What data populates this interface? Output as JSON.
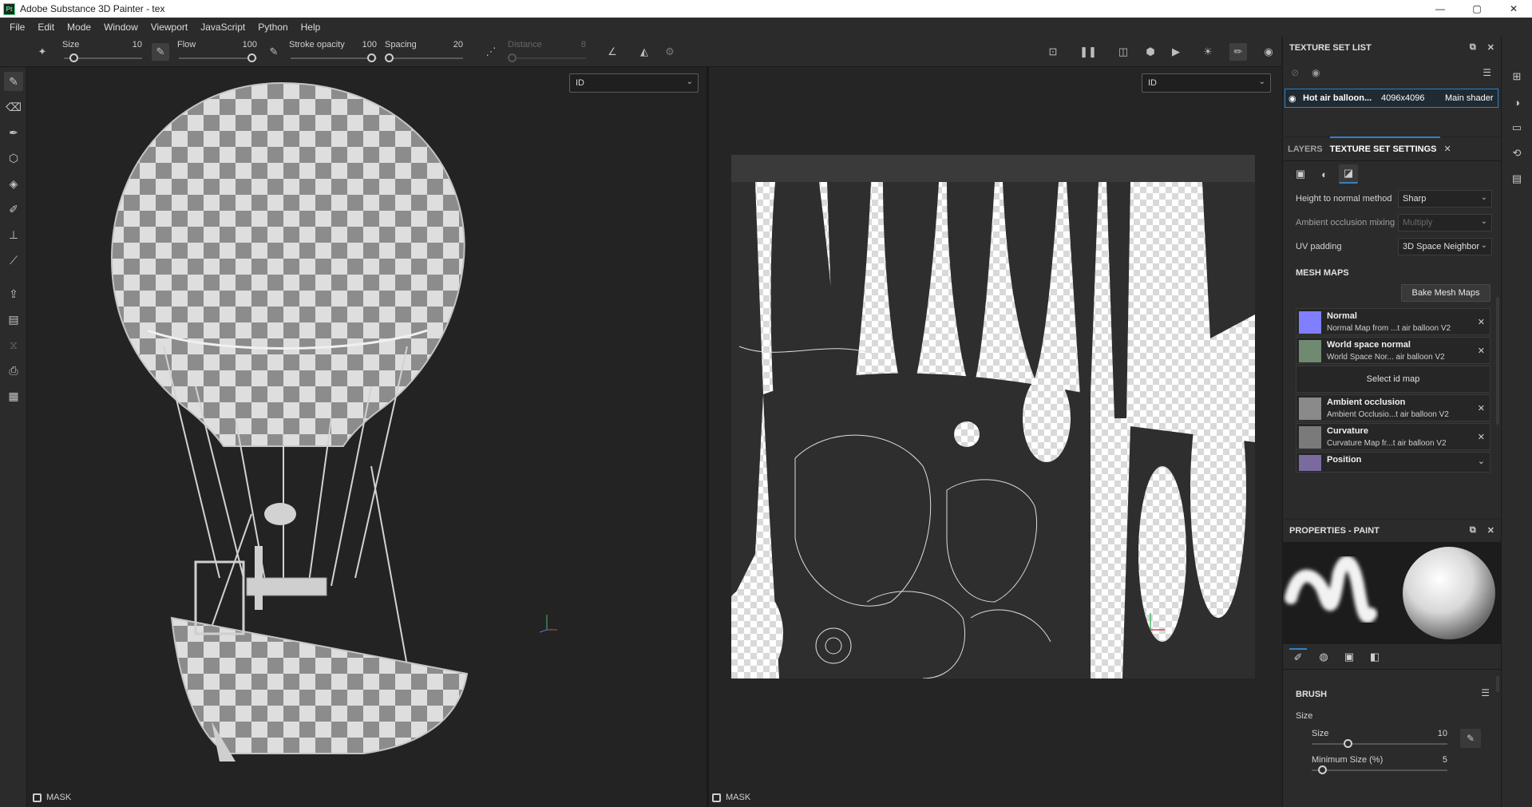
{
  "window": {
    "logo": "Pt",
    "title": "Adobe Substance 3D Painter - tex",
    "controls": [
      "—",
      "▢",
      "✕"
    ]
  },
  "menu": [
    "File",
    "Edit",
    "Mode",
    "Window",
    "Viewport",
    "JavaScript",
    "Python",
    "Help"
  ],
  "toolbar": {
    "size": {
      "label": "Size",
      "value": "10",
      "level": 0.1
    },
    "flow": {
      "label": "Flow",
      "value": "100",
      "level": 1.0
    },
    "stroke_opacity": {
      "label": "Stroke opacity",
      "value": "100",
      "level": 1.0
    },
    "spacing": {
      "label": "Spacing",
      "value": "20",
      "level": 0.0
    },
    "distance": {
      "label": "Distance",
      "value": "8",
      "level": 0.0
    }
  },
  "viewport_left": {
    "channel_select": "ID",
    "mask_label": "MASK"
  },
  "viewport_right": {
    "channel_select": "ID",
    "mask_label": "MASK"
  },
  "texture_set_list": {
    "title": "TEXTURE SET LIST",
    "item": {
      "name": "Hot air balloon...",
      "resolution": "4096x4096",
      "shader": "Main shader"
    }
  },
  "texture_set_settings": {
    "tabs": [
      "LAYERS",
      "TEXTURE SET SETTINGS"
    ],
    "height_to_normal": {
      "label": "Height to normal method",
      "value": "Sharp"
    },
    "ao_mixing": {
      "label": "Ambient occlusion mixing",
      "value": "Multiply"
    },
    "uv_padding": {
      "label": "UV padding",
      "value": "3D Space Neighbor"
    },
    "mesh_maps_title": "MESH MAPS",
    "bake_button": "Bake Mesh Maps",
    "select_id_map": "Select id map",
    "maps": [
      {
        "name": "Normal",
        "source": "Normal Map from ...t air balloon V2",
        "color": "#7f7fff"
      },
      {
        "name": "World space normal",
        "source": "World Space Nor... air balloon V2",
        "color": "#6f8a70"
      },
      {
        "name": "Ambient occlusion",
        "source": "Ambient Occlusio...t air balloon V2",
        "color": "#8a8a8a"
      },
      {
        "name": "Curvature",
        "source": "Curvature Map fr...t air balloon V2",
        "color": "#7a7a7a"
      },
      {
        "name": "Position",
        "source": "",
        "color": "#7a6aa0"
      }
    ]
  },
  "properties": {
    "title": "PROPERTIES - PAINT",
    "brush_title": "BRUSH",
    "size_group": "Size",
    "size": {
      "label": "Size",
      "value": "10",
      "level": 0.25
    },
    "min_size": {
      "label": "Minimum Size (%)",
      "value": "5",
      "level": 0.05
    }
  },
  "colors": {
    "accent": "#2f82c8",
    "panel": "#2b2b2b",
    "viewport": "#232323"
  }
}
